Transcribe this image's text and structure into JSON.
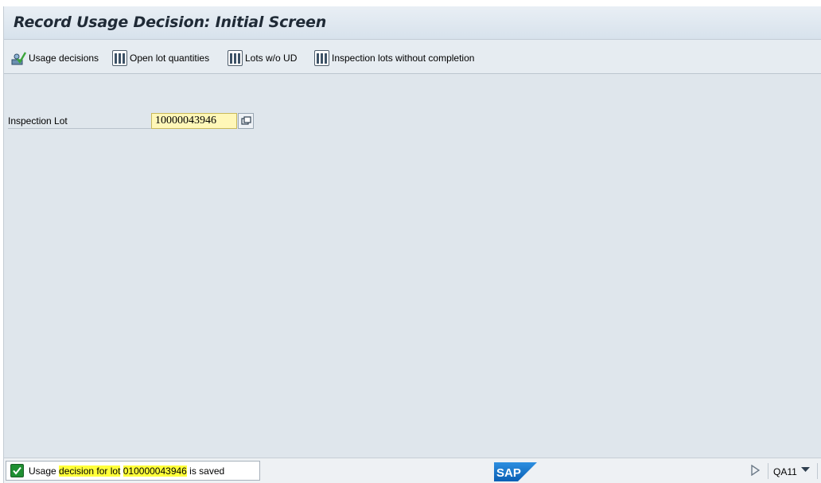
{
  "window": {
    "title": "Record Usage Decision: Initial Screen"
  },
  "toolbar": {
    "buttons": [
      {
        "label": "Usage decisions",
        "icon": "usage-decision-icon"
      },
      {
        "label": "Open lot quantities",
        "icon": "worklist-icon"
      },
      {
        "label": "Lots w/o UD",
        "icon": "worklist-icon"
      },
      {
        "label": "Inspection lots without completion",
        "icon": "worklist-icon"
      }
    ]
  },
  "form": {
    "inspection_lot_label": "Inspection Lot",
    "inspection_lot_value": "10000043946"
  },
  "status": {
    "msg_prefix": "Usage ",
    "msg_highlight_1": "decision for lot",
    "msg_middle": " ",
    "msg_highlight_2": "010000043946",
    "msg_suffix": " is saved",
    "icon": "success-check-icon"
  },
  "footer": {
    "logo": "SAP",
    "transaction_code": "QA11"
  },
  "colors": {
    "input_bg": "#fff7b8",
    "highlight": "#ffff3a",
    "success": "#1f8f32",
    "sap_blue": "#0a6ed1"
  }
}
